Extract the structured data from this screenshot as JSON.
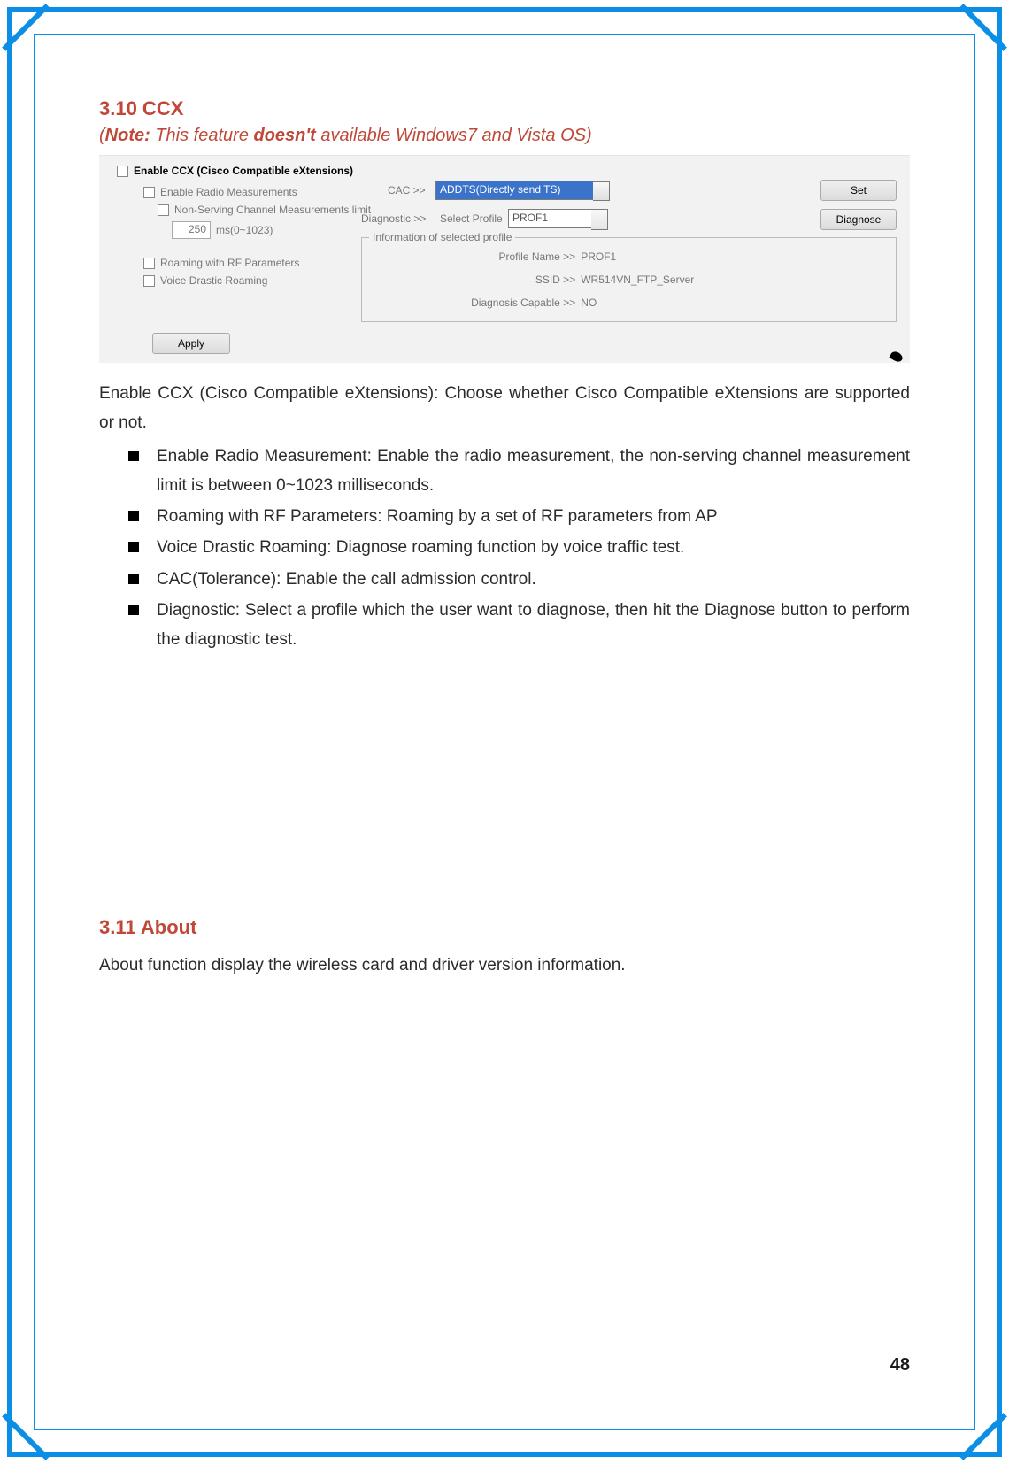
{
  "sections": {
    "ccx_heading": "3.10 CCX",
    "note_prefix": "(",
    "note_bold1": "Note:",
    "note_mid": " This feature ",
    "note_bold2": "doesn't",
    "note_suffix": " available Windows7 and Vista OS)",
    "about_heading": "3.11 About",
    "about_text": "About function display the wireless card and driver version information."
  },
  "panel": {
    "enable_ccx": "Enable CCX (Cisco Compatible eXtensions)",
    "enable_radio": "Enable Radio Measurements",
    "non_serving": "Non-Serving Channel Measurements limit",
    "ms_value": "250",
    "ms_label": "ms(0~1023)",
    "roaming_rf": "Roaming with RF Parameters",
    "voice_drastic": "Voice Drastic Roaming",
    "cac_label": "CAC >>",
    "cac_option": "ADDTS(Directly send TS)",
    "set_btn": "Set",
    "diag_label": "Diagnostic >>",
    "select_profile_label": "Select Profile",
    "profile_value": "PROF1",
    "diagnose_btn": "Diagnose",
    "fieldset_legend": "Information of selected profile",
    "profile_name_lbl": "Profile Name >>",
    "profile_name_val": "PROF1",
    "ssid_lbl": "SSID >>",
    "ssid_val": "WR514VN_FTP_Server",
    "diag_capable_lbl": "Diagnosis Capable >>",
    "diag_capable_val": "NO",
    "apply_btn": "Apply"
  },
  "body": {
    "intro": "Enable CCX (Cisco Compatible eXtensions): Choose whether Cisco Compatible eXtensions are supported or not.",
    "bullets": [
      "Enable Radio Measurement: Enable the radio measurement, the non-serving channel measurement limit is between 0~1023 milliseconds.",
      "Roaming with RF Parameters: Roaming by a set of RF parameters from AP",
      "Voice Drastic Roaming: Diagnose roaming function by voice traffic test.",
      "CAC(Tolerance): Enable the call admission control.",
      "Diagnostic: Select a profile which the user want to diagnose, then hit the Diagnose button to perform the diagnostic test."
    ]
  },
  "page_number": "48"
}
